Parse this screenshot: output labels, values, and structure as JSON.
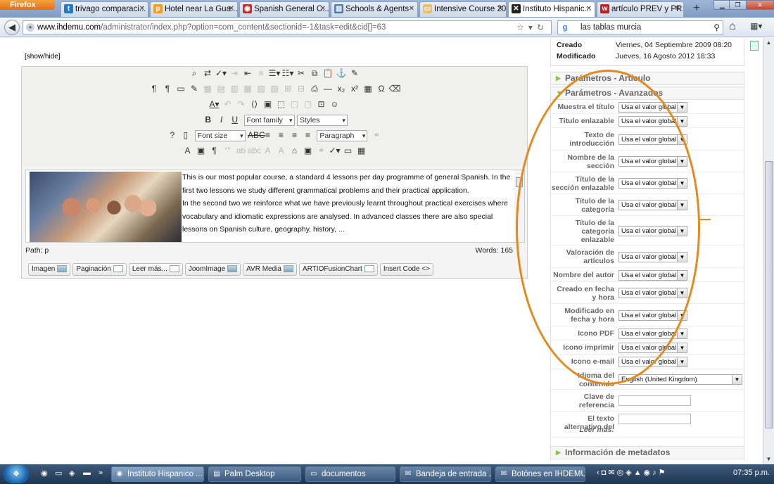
{
  "browser": {
    "app_button": "Firefox",
    "tabs": [
      {
        "label": "trivago comparaci...",
        "icon": "trivago-icon",
        "color": "#2a7ac0",
        "glyph": "t"
      },
      {
        "label": "Hotel near La Gua...",
        "icon": "p-icon",
        "color": "#f0a020",
        "glyph": "p"
      },
      {
        "label": "Spanish General C...",
        "icon": "stop-icon",
        "color": "#c0302a",
        "glyph": "◉"
      },
      {
        "label": "Schools & Agents",
        "icon": "chart-icon",
        "color": "#4a7ab0",
        "glyph": "▥"
      },
      {
        "label": "Intensive Course 20",
        "icon": "page-icon",
        "color": "#e8c070",
        "glyph": "▭"
      },
      {
        "label": "Instituto Hispanic...",
        "icon": "joomla-icon",
        "color": "#222",
        "glyph": "✕"
      },
      {
        "label": "artículo PREV y PR...",
        "icon": "wiki-icon",
        "color": "#c02020",
        "glyph": "w"
      }
    ],
    "new_tab": "+",
    "url_domain": "www.ihdemu.com",
    "url_path": "/administrator/index.php?option=com_content&sectionid=-1&task=edit&cid[]=63",
    "url_prefix": "www.",
    "search_query": "las tablas murcia"
  },
  "editor": {
    "show_hide": "[show/hide]",
    "font_family_label": "Font family",
    "styles_label": "Styles",
    "font_size_label": "Font size",
    "format_label": "Paragraph",
    "body_paragraphs": [
      "This is our most popular course, a standard 4 lessons per day programme of general Spanish. In the first two lessons we study different grammatical problems and their practical application.",
      "In the second two we reinforce what we have previously learnt throughout practical exercises where vocabulary and idiomatic expressions are analysed. In advanced classes there are also special lessons on Spanish culture, geography, history, ..."
    ],
    "path_label": "Path: p",
    "words_label": "Words: 165",
    "xtd_buttons": [
      "Imagen",
      "Paginación",
      "Leer más...",
      "JoomImage",
      "AVR Media",
      "ARTIOFusionChart",
      "Insert Code"
    ]
  },
  "right_panel": {
    "created_label": "Creado",
    "created_value": "Viernes, 04 Septiembre 2009 08:20",
    "modified_label": "Modificado",
    "modified_value": "Jueves, 16 Agosto 2012 18:33",
    "param_article": "Parámetros - Artículo",
    "param_advanced": "Parámetros - Avanzados",
    "metadata": "Información de metadatos",
    "global_value": "Usa el valor global",
    "language_value": "English (United Kingdom)",
    "rows": [
      {
        "label": "Muestra el título"
      },
      {
        "label": "Título enlazable"
      },
      {
        "label": "Texto de introducción"
      },
      {
        "label": "Nombre de la sección"
      },
      {
        "label": "Título de la sección enlazable"
      },
      {
        "label": "Título de la categoría"
      },
      {
        "label": "Título de la categoría enlazable"
      },
      {
        "label": "Valoración de artículos"
      },
      {
        "label": "Nombre del autor"
      },
      {
        "label": "Creado en fecha y hora"
      },
      {
        "label": "Modificado en fecha y hora"
      },
      {
        "label": "Icono PDF"
      },
      {
        "label": "Icono imprimir"
      },
      {
        "label": "Icono e-mail"
      },
      {
        "label": "Idioma del contenido"
      },
      {
        "label": "Clave de referencia"
      },
      {
        "label": "El texto alternativo del"
      },
      {
        "label": "Leer más:"
      }
    ]
  },
  "taskbar": {
    "items": [
      {
        "label": "Instituto Hispanico ...",
        "glyph": "◉"
      },
      {
        "label": "Palm Desktop",
        "glyph": "▤"
      },
      {
        "label": "documentos",
        "glyph": "▭"
      },
      {
        "label": "Bandeja de entrada ...",
        "glyph": "✉"
      },
      {
        "label": "Botónes en IHDEMU...",
        "glyph": "✉"
      }
    ],
    "clock": "07:35 p.m."
  },
  "colors": {
    "annotation_ellipse": "#e38a1e",
    "panel_arrow": "#8bc34a"
  }
}
